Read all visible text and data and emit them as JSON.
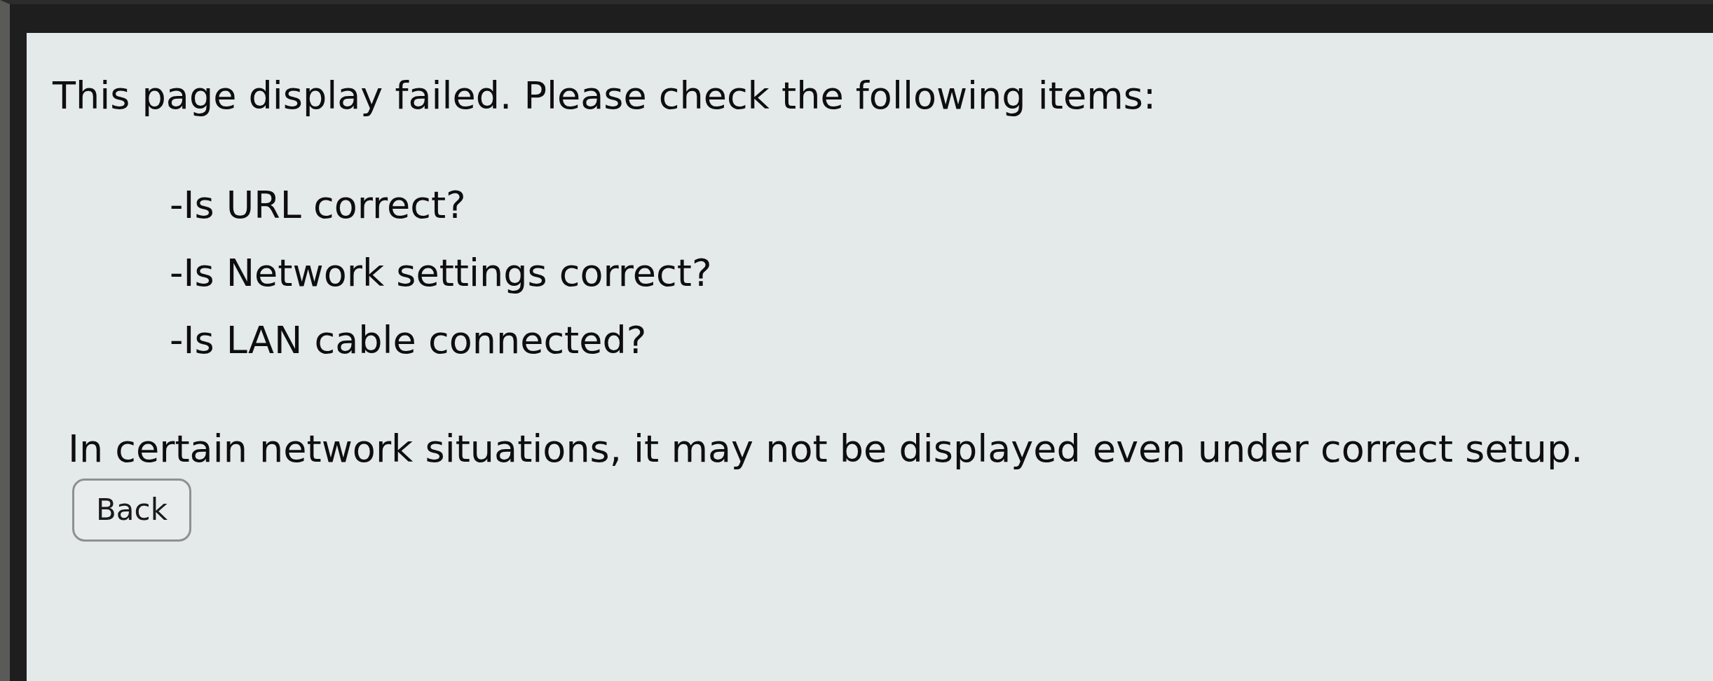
{
  "message": {
    "heading": "This page display failed. Please check the following items:",
    "checklist": [
      "-Is URL correct?",
      "-Is Network settings correct?",
      "-Is LAN cable connected?"
    ],
    "note": "In certain network situations, it may not be displayed even under correct setup."
  },
  "back_button": {
    "label": "Back"
  }
}
